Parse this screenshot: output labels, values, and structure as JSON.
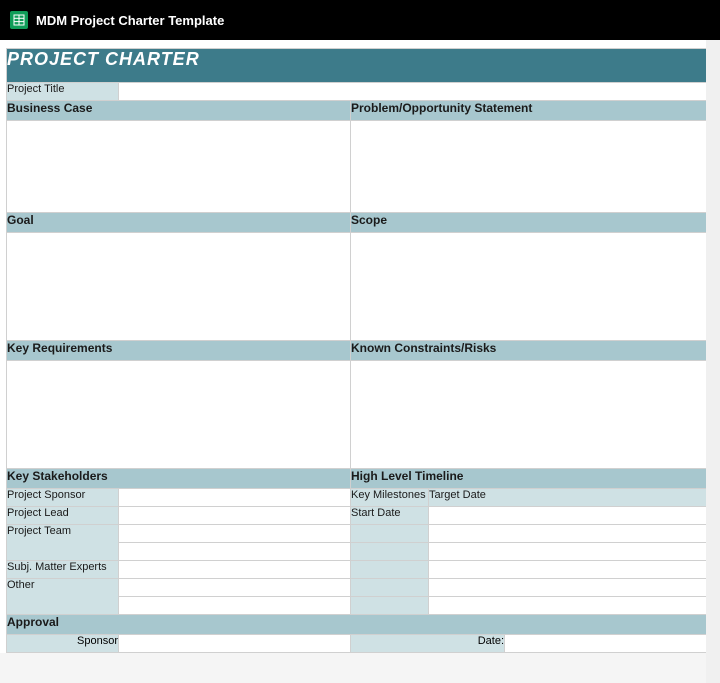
{
  "topbar": {
    "title": "MDM Project Charter Template"
  },
  "banner": "PROJECT CHARTER",
  "rows": {
    "project_title_label": "Project Title",
    "project_title_value": "",
    "business_case": "Business Case",
    "problem_statement": "Problem/Opportunity Statement",
    "goal": "Goal",
    "scope": "Scope",
    "key_requirements": "Key Requirements",
    "known_constraints": "Known Constraints/Risks",
    "key_stakeholders": "Key Stakeholders",
    "high_level_timeline": "High Level Timeline"
  },
  "stakeholders": {
    "sponsor": "Project Sponsor",
    "lead": "Project Lead",
    "team": "Project Team",
    "sme": "Subj. Matter Experts",
    "other": "Other"
  },
  "timeline": {
    "milestones": "Key Milestones",
    "target_date": "Target Date",
    "start_date": "Start Date"
  },
  "approval": {
    "label": "Approval",
    "sponsor": "Sponsor",
    "date": "Date:"
  }
}
